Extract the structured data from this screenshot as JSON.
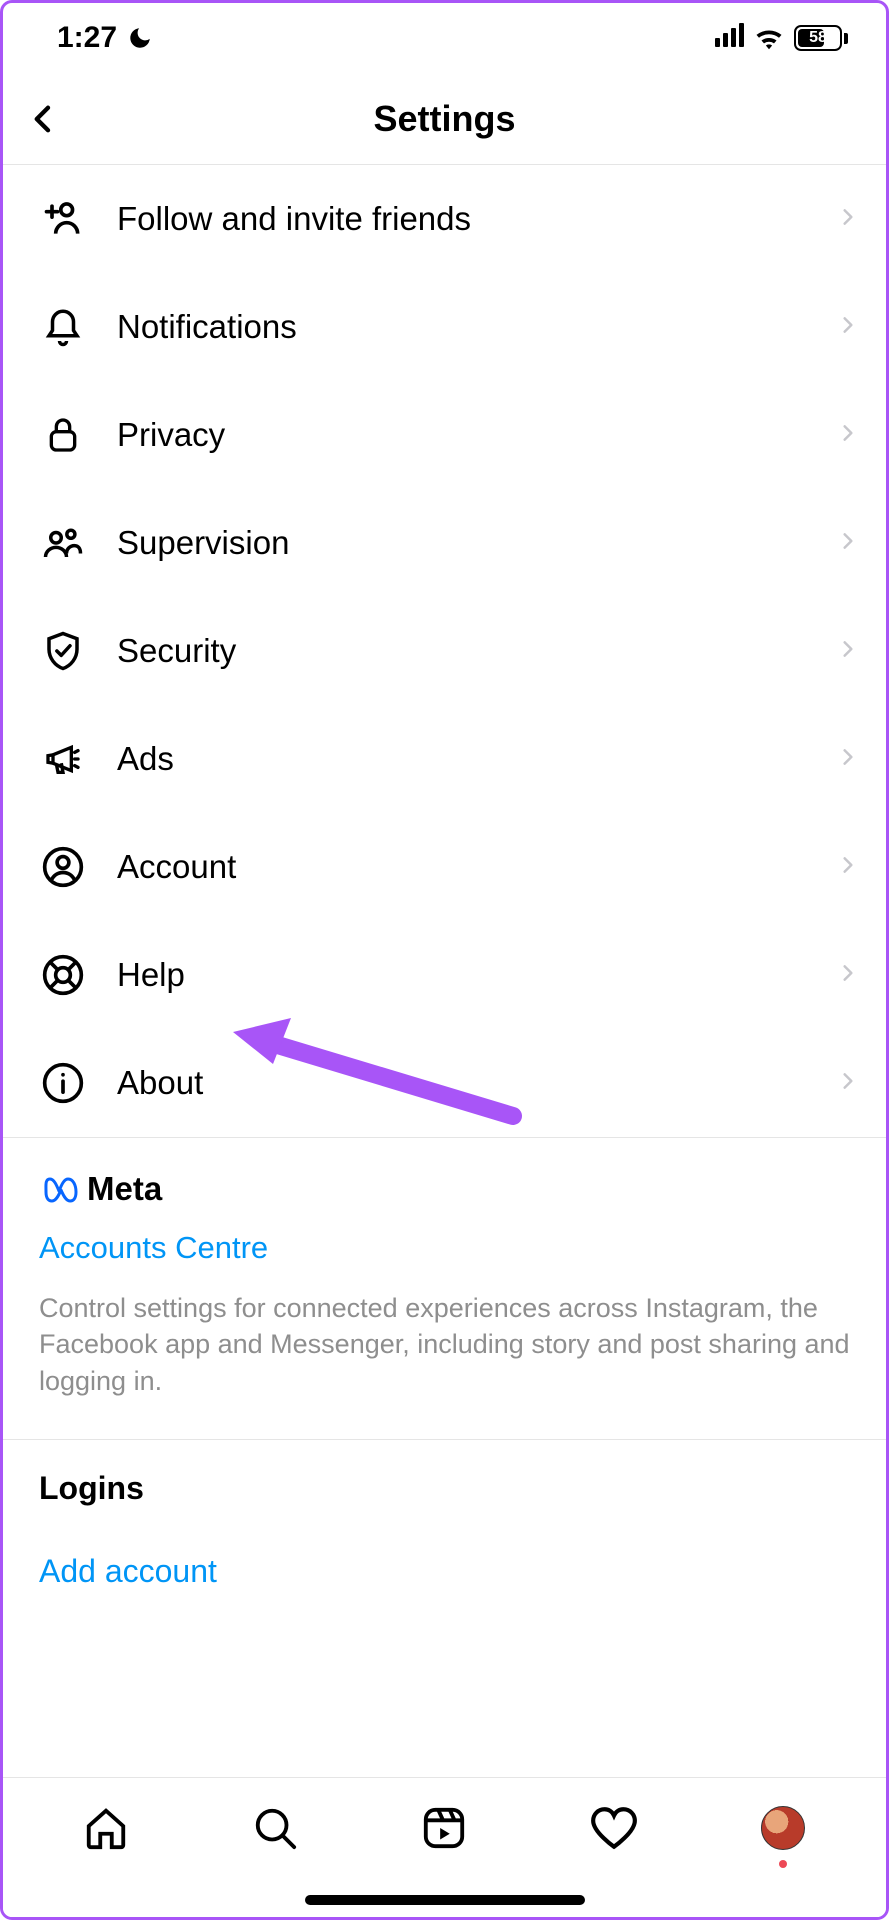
{
  "status": {
    "time": "1:27",
    "battery": "58"
  },
  "header": {
    "title": "Settings"
  },
  "items": [
    {
      "label": "Follow and invite friends",
      "icon": "add-user-icon"
    },
    {
      "label": "Notifications",
      "icon": "bell-icon"
    },
    {
      "label": "Privacy",
      "icon": "lock-icon"
    },
    {
      "label": "Supervision",
      "icon": "people-icon"
    },
    {
      "label": "Security",
      "icon": "shield-check-icon"
    },
    {
      "label": "Ads",
      "icon": "megaphone-icon"
    },
    {
      "label": "Account",
      "icon": "user-circle-icon"
    },
    {
      "label": "Help",
      "icon": "lifebuoy-icon"
    },
    {
      "label": "About",
      "icon": "info-icon"
    }
  ],
  "meta": {
    "brand": "Meta",
    "link": "Accounts Centre",
    "description": "Control settings for connected experiences across Instagram, the Facebook app and Messenger, including story and post sharing and logging in."
  },
  "logins": {
    "title": "Logins",
    "add": "Add account"
  }
}
